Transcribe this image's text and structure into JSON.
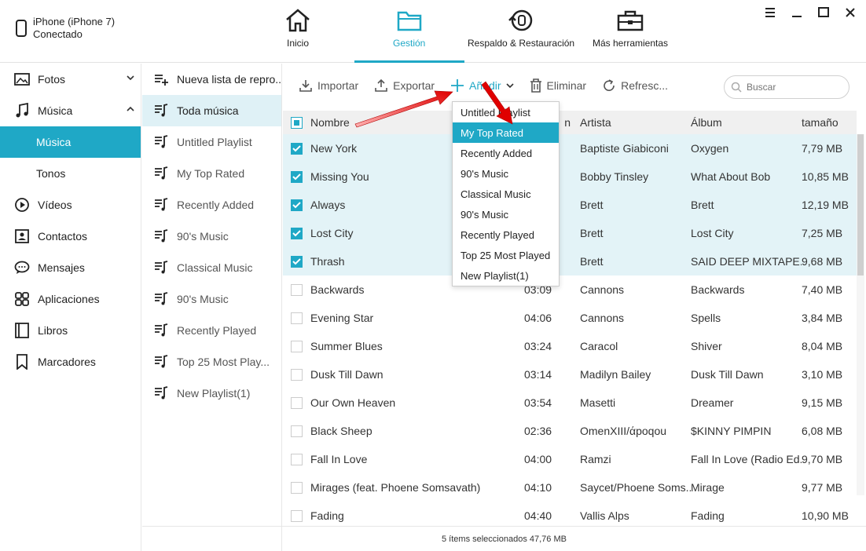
{
  "device": {
    "name": "iPhone (iPhone 7)",
    "status": "Conectado"
  },
  "nav": [
    {
      "label": "Inicio",
      "icon": "home-icon"
    },
    {
      "label": "Gestión",
      "icon": "folder-icon"
    },
    {
      "label": "Respaldo & Restauración",
      "icon": "restore-icon"
    },
    {
      "label": "Más herramientas",
      "icon": "toolbox-icon"
    }
  ],
  "accent": "#1fa8c6",
  "sidebar": {
    "items": [
      {
        "label": "Fotos",
        "icon": "photo-icon"
      },
      {
        "label": "Música",
        "icon": "music-icon"
      },
      {
        "label": "Música",
        "sub": true
      },
      {
        "label": "Tonos",
        "sub": true
      },
      {
        "label": "Vídeos",
        "icon": "video-icon"
      },
      {
        "label": "Contactos",
        "icon": "contacts-icon"
      },
      {
        "label": "Mensajes",
        "icon": "messages-icon"
      },
      {
        "label": "Aplicaciones",
        "icon": "apps-icon"
      },
      {
        "label": "Libros",
        "icon": "books-icon"
      },
      {
        "label": "Marcadores",
        "icon": "bookmark-icon"
      }
    ]
  },
  "playlists": {
    "new_label": "Nueva lista de repro...",
    "items": [
      "Toda música",
      "Untitled Playlist",
      "My Top Rated",
      "Recently Added",
      "90's Music",
      "Classical Music",
      "90's Music",
      "Recently Played",
      "Top 25 Most Play...",
      "New Playlist(1)"
    ]
  },
  "toolbar": {
    "import": "Importar",
    "export": "Exportar",
    "add": "Añadir",
    "delete": "Eliminar",
    "refresh": "Refresc...",
    "search_placeholder": "Buscar"
  },
  "table": {
    "headers": {
      "name": "Nombre",
      "duration": "n",
      "artist": "Artista",
      "album": "Álbum",
      "size": "tamaño"
    },
    "rows": [
      {
        "name": "New York",
        "duration": "",
        "artist": "Baptiste Giabiconi",
        "album": "Oxygen",
        "size": "7,79 MB",
        "checked": true
      },
      {
        "name": "Missing You",
        "duration": "",
        "artist": "Bobby Tinsley",
        "album": "What About Bob",
        "size": "10,85 MB",
        "checked": true
      },
      {
        "name": "Always",
        "duration": "",
        "artist": "Brett",
        "album": "Brett",
        "size": "12,19 MB",
        "checked": true
      },
      {
        "name": "Lost City",
        "duration": "",
        "artist": "Brett",
        "album": "Lost City",
        "size": "7,25 MB",
        "checked": true
      },
      {
        "name": "Thrash",
        "duration": "",
        "artist": "Brett",
        "album": "SAID DEEP MIXTAPE...",
        "size": "9,68 MB",
        "checked": true
      },
      {
        "name": "Backwards",
        "duration": "03:09",
        "artist": "Cannons",
        "album": "Backwards",
        "size": "7,40 MB",
        "checked": false
      },
      {
        "name": "Evening Star",
        "duration": "04:06",
        "artist": "Cannons",
        "album": "Spells",
        "size": "3,84 MB",
        "checked": false
      },
      {
        "name": "Summer Blues",
        "duration": "03:24",
        "artist": "Caracol",
        "album": "Shiver",
        "size": "8,04 MB",
        "checked": false
      },
      {
        "name": "Dusk Till Dawn",
        "duration": "03:14",
        "artist": "Madilyn Bailey",
        "album": "Dusk Till Dawn",
        "size": "3,10 MB",
        "checked": false
      },
      {
        "name": "Our Own Heaven",
        "duration": "03:54",
        "artist": "Masetti",
        "album": "Dreamer",
        "size": "9,15 MB",
        "checked": false
      },
      {
        "name": "Black Sheep",
        "duration": "02:36",
        "artist": "OmenXIII/άpoqou",
        "album": "$KINNY PIMPIN",
        "size": "6,08 MB",
        "checked": false
      },
      {
        "name": "Fall In Love",
        "duration": "04:00",
        "artist": "Ramzi",
        "album": "Fall In Love (Radio Ed...",
        "size": "9,70 MB",
        "checked": false
      },
      {
        "name": "Mirages (feat. Phoene Somsavath)",
        "duration": "04:10",
        "artist": "Saycet/Phoene Soms...",
        "album": "Mirage",
        "size": "9,77 MB",
        "checked": false
      },
      {
        "name": "Fading",
        "duration": "04:40",
        "artist": "Vallis Alps",
        "album": "Fading",
        "size": "10,90 MB",
        "checked": false
      }
    ]
  },
  "dropdown": {
    "items": [
      "Untitled Playlist",
      "My Top Rated",
      "Recently Added",
      "90's Music",
      "Classical Music",
      "90's Music",
      "Recently Played",
      "Top 25 Most Played",
      "New Playlist(1)"
    ],
    "active": "My Top Rated"
  },
  "status": "5 ítems seleccionados 47,76 MB"
}
